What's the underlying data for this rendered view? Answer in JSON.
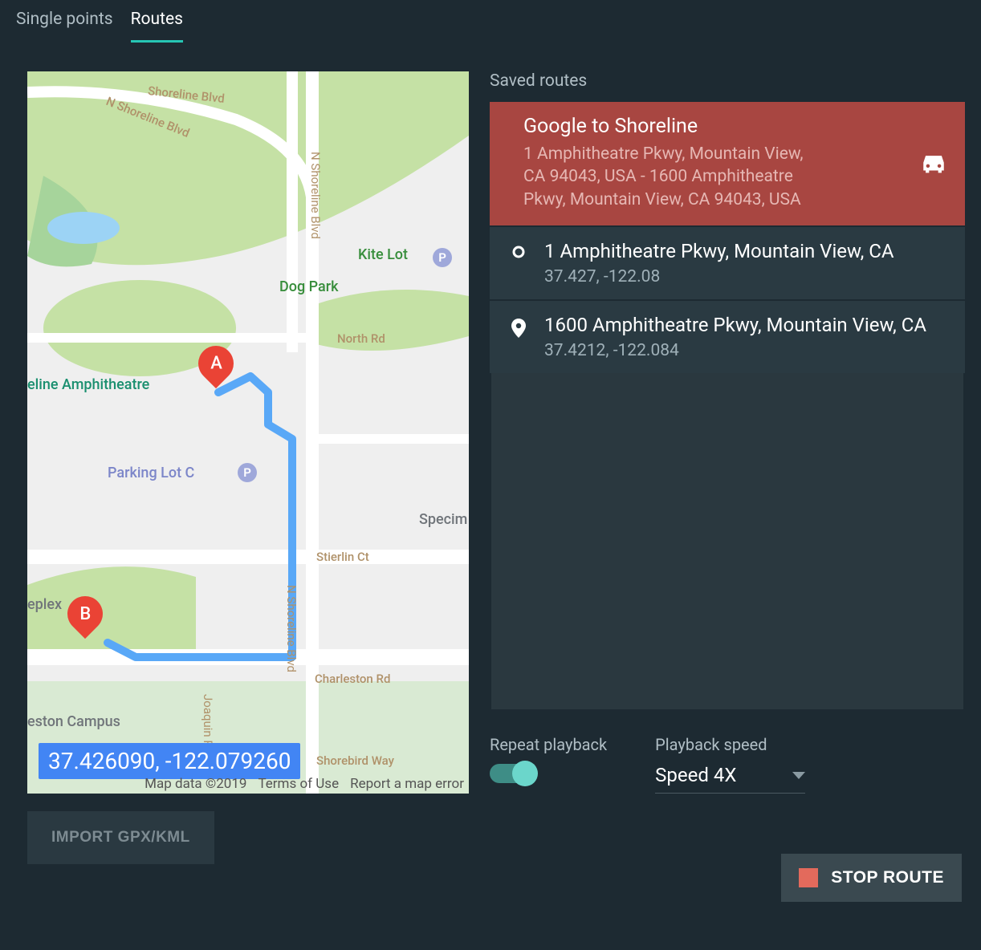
{
  "tabs": {
    "single_points": "Single points",
    "routes": "Routes"
  },
  "map": {
    "coord_chip": "37.426090, -122.079260",
    "footer_data": "Map data ©2019",
    "footer_terms": "Terms of Use",
    "footer_report": "Report a map error",
    "pin_a": "A",
    "pin_b": "B",
    "labels": {
      "kite_lot": "Kite Lot",
      "dog_park": "Dog Park",
      "shoreline_amph": "eline Amphitheatre",
      "parking_lot_c": "Parking Lot C",
      "specim": "Specim",
      "eplex": "eplex",
      "eston_campus": "eston Campus",
      "shoreline_blvd_1": "Shoreline Blvd",
      "n_shoreline_1": "N Shoreline Blvd",
      "n_shoreline_2": "N Shoreline Blvd",
      "north_rd": "North Rd",
      "stierlin_ct": "Stierlin Ct",
      "charleston_rd": "Charleston Rd",
      "shorebird_way": "Shorebird Way",
      "joaquin": "Joaquin R"
    }
  },
  "buttons": {
    "import": "IMPORT GPX/KML",
    "stop": "STOP ROUTE"
  },
  "panel": {
    "title": "Saved routes",
    "route_name": "Google to Shoreline",
    "route_desc": "1 Amphitheatre Pkwy, Mountain View, CA 94043, USA - 1600 Amphitheatre Pkwy, Mountain View, CA 94043, USA",
    "wp1_title": "1 Amphitheatre Pkwy, Mountain View, CA",
    "wp1_sub": "37.427, -122.08",
    "wp2_title": "1600 Amphitheatre Pkwy, Mountain View, CA",
    "wp2_sub": "37.4212, -122.084"
  },
  "controls": {
    "repeat_label": "Repeat playback",
    "speed_label": "Playback speed",
    "speed_value": "Speed 4X"
  }
}
